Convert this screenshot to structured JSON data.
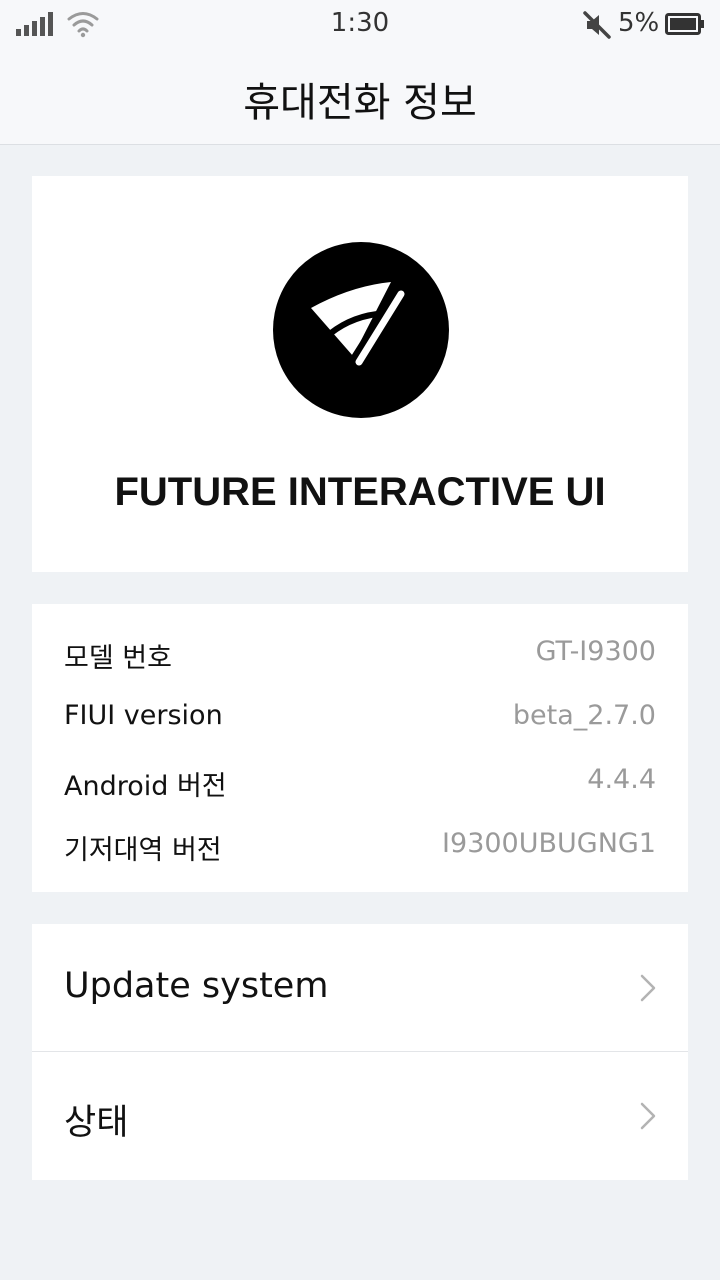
{
  "status_bar": {
    "time": "1:30",
    "battery_percent": "5%",
    "icons": [
      "signal-icon",
      "wifi-icon",
      "mute-icon",
      "battery-icon"
    ]
  },
  "header": {
    "title": "휴대전화 정보"
  },
  "brand": {
    "logo_icon": "fiui-logo-icon",
    "name": "FUTURE INTERACTIVE UI"
  },
  "info": {
    "rows": [
      {
        "label": "모델 번호",
        "value": "GT-I9300"
      },
      {
        "label": "FIUI version",
        "value": "beta_2.7.0"
      },
      {
        "label": "Android 버전",
        "value": "4.4.4"
      },
      {
        "label": "기저대역 버전",
        "value": "I9300UBUGNG1"
      }
    ]
  },
  "actions": {
    "items": [
      {
        "label": "Update system",
        "icon": "chevron-right-icon"
      },
      {
        "label": "상태",
        "icon": "chevron-right-icon"
      }
    ]
  },
  "colors": {
    "background": "#eff2f5",
    "bar": "#f7f8fa",
    "card": "#ffffff",
    "text": "#111111",
    "muted": "#9a9a9a"
  }
}
